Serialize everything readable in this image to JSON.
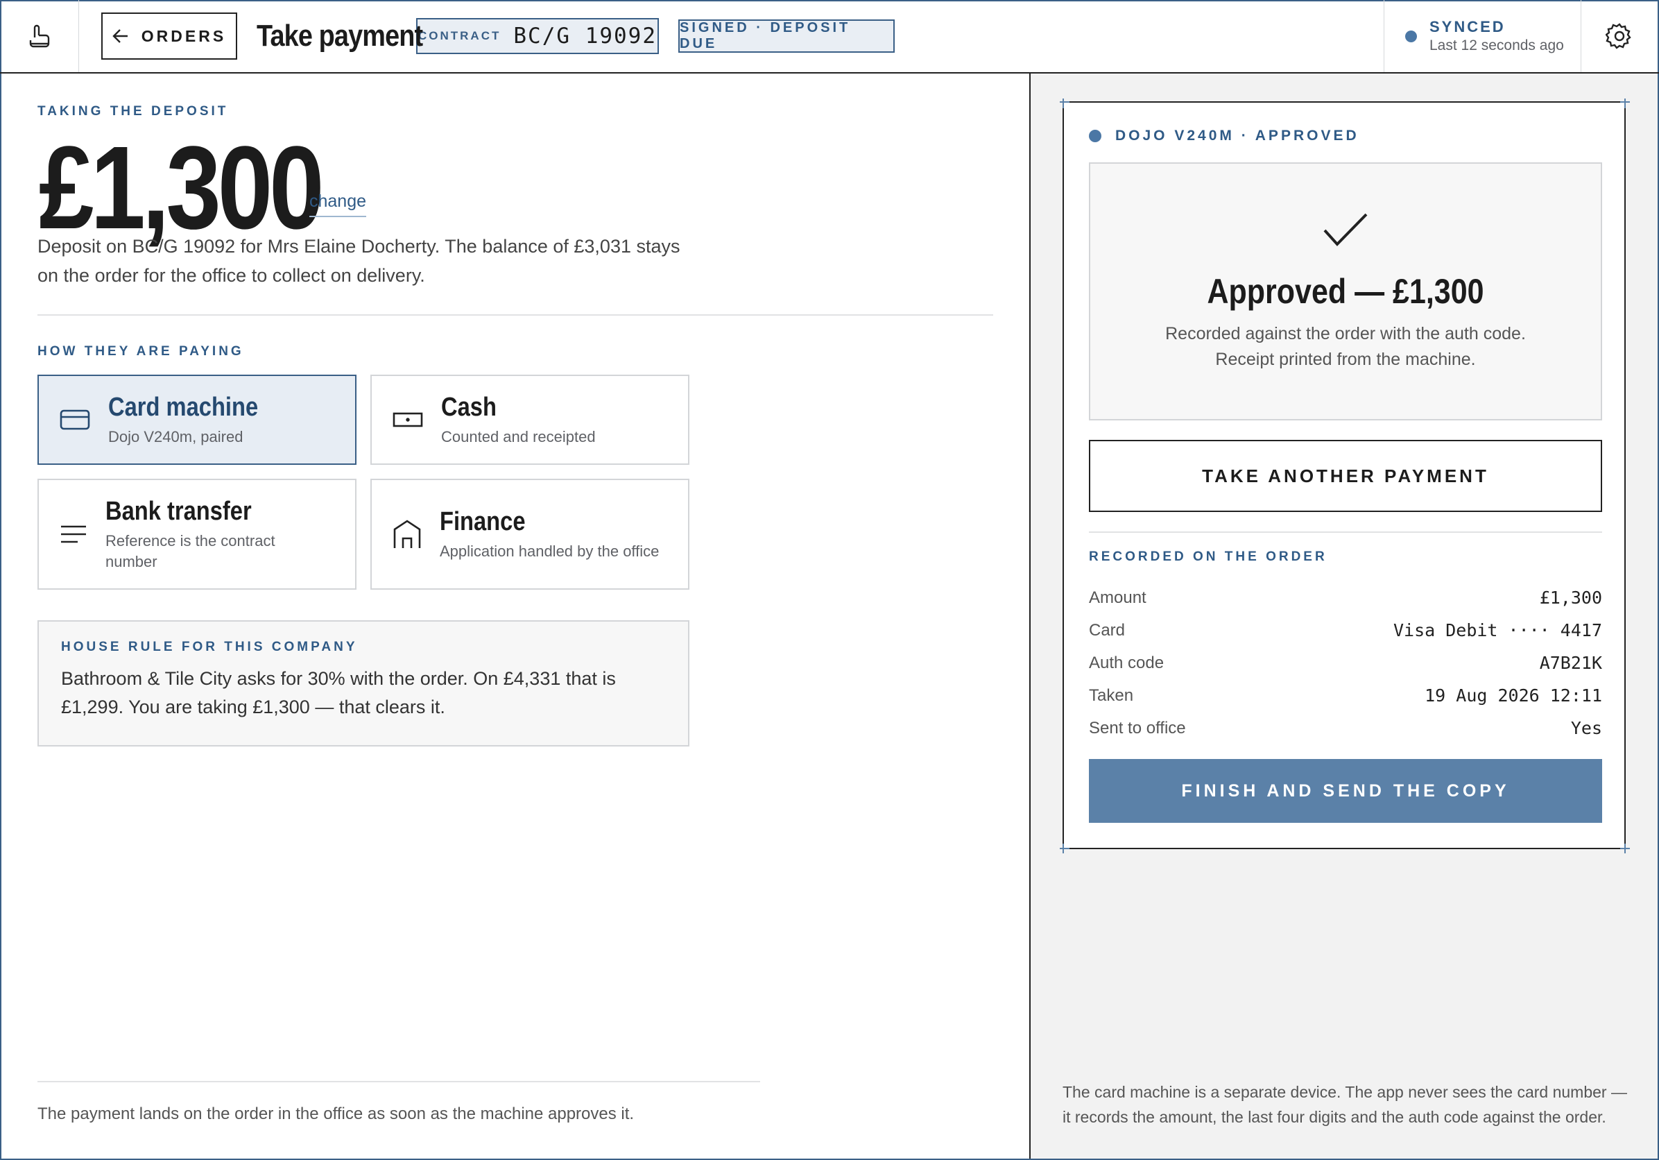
{
  "topbar": {
    "back_label": "ORDERS",
    "title": "Take payment",
    "contract_label": "CONTRACT",
    "contract_value": "BC/G 19092",
    "status": "SIGNED · DEPOSIT DUE",
    "sync_title": "SYNCED",
    "sync_sub": "Last 12 seconds ago"
  },
  "deposit": {
    "eyebrow": "TAKING THE DEPOSIT",
    "amount": "£1,300",
    "change_label": "change",
    "description": "Deposit on BC/G 19092 for Mrs Elaine Docherty. The balance of £3,031 stays on the order for the office to collect on delivery."
  },
  "payment_methods": {
    "eyebrow": "HOW THEY ARE PAYING",
    "items": [
      {
        "name": "Card machine",
        "sub": "Dojo V240m, paired",
        "selected": true,
        "icon": "card-icon"
      },
      {
        "name": "Cash",
        "sub": "Counted and receipted",
        "selected": false,
        "icon": "cash-icon"
      },
      {
        "name": "Bank transfer",
        "sub": "Reference is the contract number",
        "selected": false,
        "icon": "lines-icon"
      },
      {
        "name": "Finance",
        "sub": "Application handled by the office",
        "selected": false,
        "icon": "building-icon"
      }
    ]
  },
  "house_rule": {
    "eyebrow": "HOUSE RULE FOR THIS COMPANY",
    "text": "Bathroom & Tile City asks for 30% with the order. On £4,331 that is £1,299. You are taking £1,300 — that clears it."
  },
  "footer_left": "The payment lands on the order in the office as soon as the machine approves it.",
  "result": {
    "device_status": "DOJO V240M · APPROVED",
    "heading": "Approved — £1,300",
    "line1": "Recorded against the order with the auth code.",
    "line2": "Receipt printed from the machine.",
    "another_label": "TAKE ANOTHER PAYMENT",
    "recorded_eyebrow": "RECORDED ON THE ORDER",
    "fields": [
      {
        "key": "Amount",
        "value": "£1,300"
      },
      {
        "key": "Card",
        "value": "Visa Debit ···· 4417"
      },
      {
        "key": "Auth code",
        "value": "A7B21K"
      },
      {
        "key": "Taken",
        "value": "19 Aug 2026 12:11"
      },
      {
        "key": "Sent to office",
        "value": "Yes"
      }
    ],
    "finish_label": "FINISH AND SEND THE COPY"
  },
  "footer_right": "The card machine is a separate device. The app never sees the card number — it records the amount, the last four digits and the auth code against the order.",
  "colors": {
    "accent": "#2f5a86",
    "button_fill": "#5b81a8",
    "selected_bg": "#e7edf4",
    "panel_bg": "#f2f2f2"
  }
}
